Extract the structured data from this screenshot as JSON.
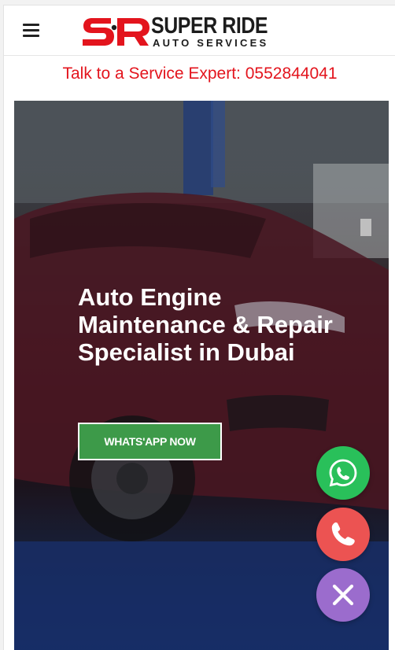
{
  "header": {
    "menu_icon": "hamburger-icon",
    "logo": {
      "monogram": "SR",
      "name": "SUPER RIDE",
      "tagline": "AUTO SERVICES",
      "colors": {
        "monogram": "#e3141d",
        "text": "#1c1c1c"
      }
    }
  },
  "banner": {
    "text": "Talk to a Service Expert: 0552844041",
    "color": "#e3141d"
  },
  "hero": {
    "title": "Auto Engine Maintenance & Repair Specialist in Dubai",
    "cta_label": "WHATS'APP NOW",
    "cta_color": "#3d9a49"
  },
  "floating_actions": [
    {
      "name": "whatsapp",
      "icon": "whatsapp-icon",
      "color": "#29c05a"
    },
    {
      "name": "call",
      "icon": "phone-icon",
      "color": "#ec5352"
    },
    {
      "name": "close",
      "icon": "close-icon",
      "color": "#9b6ccd"
    }
  ]
}
